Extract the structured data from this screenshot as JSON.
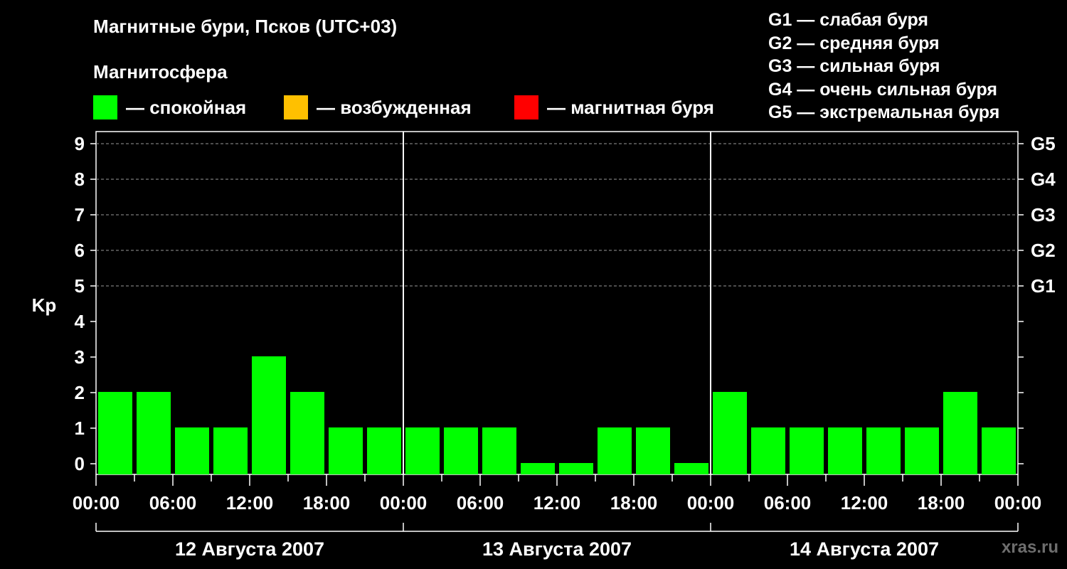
{
  "header": {
    "title": "Магнитные бури, Псков (UTC+03)",
    "subtitle": "Магнитосфера",
    "site": "xras.ru"
  },
  "legend": [
    {
      "label": "— спокойная",
      "color": "#00ff00"
    },
    {
      "label": "— возбужденная",
      "color": "#ffc000"
    },
    {
      "label": "— магнитная буря",
      "color": "#ff0000"
    }
  ],
  "storm_levels": [
    "G1 — слабая буря",
    "G2 — средняя буря",
    "G3 — сильная буря",
    "G4 — очень сильная буря",
    "G5 — экстремальная буря"
  ],
  "chart_data": {
    "type": "bar",
    "ylabel": "Kp",
    "ylim": [
      0,
      9
    ],
    "y_ticks": [
      0,
      1,
      2,
      3,
      4,
      5,
      6,
      7,
      8,
      9
    ],
    "right_ticks": [
      {
        "kp": 5,
        "label": "G1"
      },
      {
        "kp": 6,
        "label": "G2"
      },
      {
        "kp": 7,
        "label": "G3"
      },
      {
        "kp": 8,
        "label": "G4"
      },
      {
        "kp": 9,
        "label": "G5"
      }
    ],
    "grid": "dashed horizontal at 5, 6, 7, 8, 9",
    "x_tick_labels": [
      "00:00",
      "06:00",
      "12:00",
      "18:00",
      "00:00",
      "06:00",
      "12:00",
      "18:00",
      "00:00",
      "06:00",
      "12:00",
      "18:00",
      "00:00"
    ],
    "days": [
      "12 Августа 2007",
      "13 Августа 2007",
      "14 Августа 2007"
    ],
    "interval_hours": 3,
    "bar_color": "#00ff00",
    "values": [
      2,
      2,
      1,
      1,
      3,
      2,
      1,
      1,
      1,
      1,
      1,
      0,
      0,
      1,
      1,
      0,
      2,
      1,
      1,
      1,
      1,
      1,
      2,
      1
    ]
  }
}
